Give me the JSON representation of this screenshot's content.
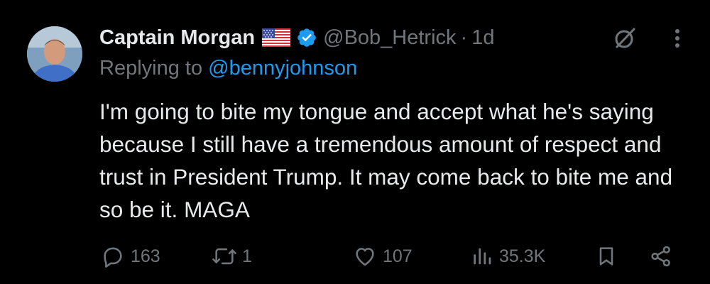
{
  "user": {
    "name": "Captain Morgan",
    "flag_icon": "us-flag-emoji",
    "verified_icon": "verified-badge-icon",
    "handle": "@Bob_Hetrick",
    "separator": "·",
    "time": "1d"
  },
  "reply": {
    "prefix": "Replying to",
    "mention": "@bennyjohnson"
  },
  "tweet_text": "I'm going to bite my tongue and accept what he's saying because I still have a tremendous amount of respect and trust in President Trump. It may come back to bite me and so be it. MAGA",
  "actions": {
    "replies": "163",
    "reposts": "1",
    "likes": "107",
    "views": "35.3K"
  },
  "colors": {
    "background": "#000000",
    "text": "#e7e9ea",
    "secondary": "#71767b",
    "accent": "#1d9bf0"
  }
}
